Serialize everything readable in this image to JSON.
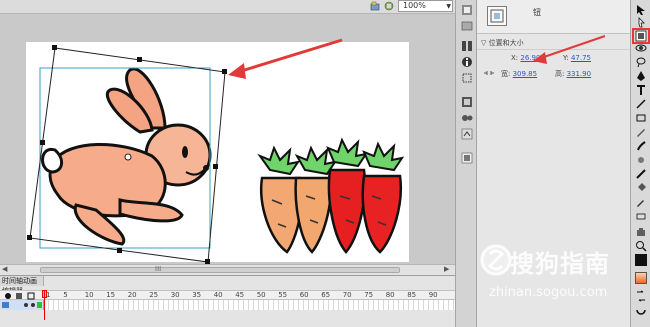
{
  "toolbar": {
    "zoom_level": "100%",
    "icons": [
      "edit-scene-icon",
      "edit-symbol-icon"
    ]
  },
  "properties": {
    "symbol_name": "钮",
    "section_title": "位置和大小",
    "x_label": "X:",
    "x_value": "26.90",
    "y_label": "Y:",
    "y_value": "47.75",
    "w_label": "宽:",
    "w_value": "309.85",
    "h_label": "高:",
    "h_value": "331.90"
  },
  "timeline": {
    "tab_label": "时间轴动画编辑器",
    "frame_numbers": [
      "1",
      "5",
      "10",
      "15",
      "20",
      "25",
      "30",
      "35",
      "40",
      "45",
      "50",
      "55",
      "60",
      "65",
      "70",
      "75",
      "80",
      "85",
      "90"
    ]
  },
  "watermark": {
    "text": "搜狗指南",
    "url": "zhinan.sogou.com"
  },
  "colors": {
    "annotation_red": "#e23a3a",
    "stage_bg": "#c9c9c9",
    "canvas": "#ffffff",
    "link_blue": "#1f5fbf"
  }
}
